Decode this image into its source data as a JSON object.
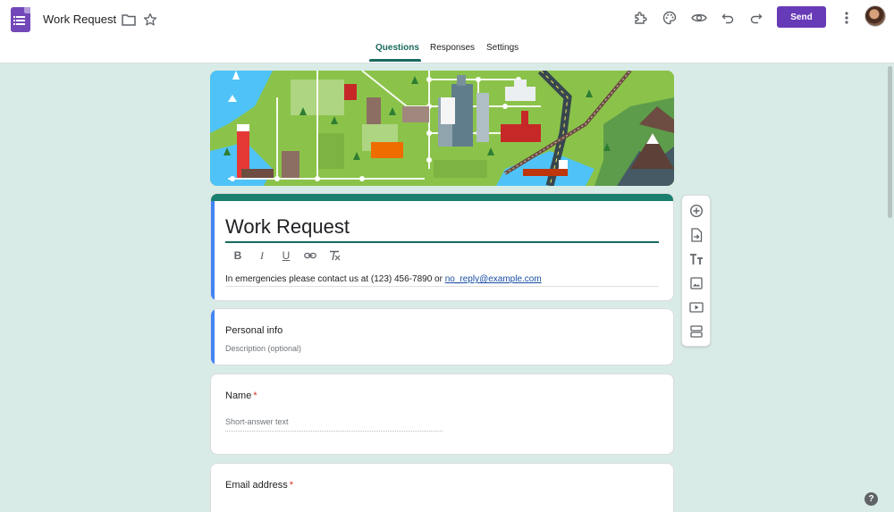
{
  "header": {
    "doc_title": "Work Request",
    "send_label": "Send"
  },
  "tabs": [
    {
      "label": "Questions",
      "active": true
    },
    {
      "label": "Responses",
      "active": false
    },
    {
      "label": "Settings",
      "active": false
    }
  ],
  "form": {
    "title": "Work Request",
    "description_prefix": "In emergencies please contact us at (123) 456-7890 or ",
    "description_link": "no_reply@example.com",
    "format_buttons": [
      "B",
      "I",
      "U"
    ]
  },
  "section": {
    "title": "Personal info",
    "description_placeholder": "Description (optional)"
  },
  "questions": [
    {
      "label": "Name",
      "required_mark": "*",
      "placeholder": "Short-answer text"
    },
    {
      "label": "Email address",
      "required_mark": "*"
    }
  ],
  "side_tools": [
    "add-question-icon",
    "import-questions-icon",
    "add-title-icon",
    "add-image-icon",
    "add-video-icon",
    "add-section-icon"
  ],
  "help_label": "?",
  "colors": {
    "accent": "#673ab7",
    "theme": "#1a6a5e",
    "background": "#d9ebe7",
    "section_accent": "#4285f4"
  }
}
